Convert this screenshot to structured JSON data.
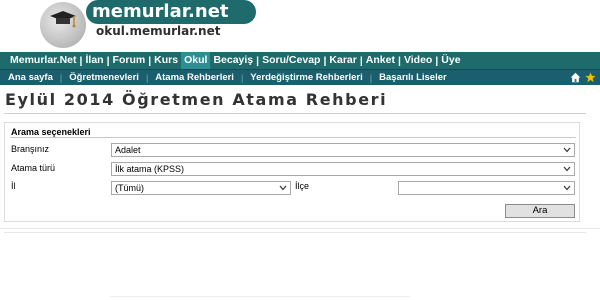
{
  "brand": {
    "logo_text": "memurlar.net",
    "sub_text": "okul.memurlar.net"
  },
  "main_nav": {
    "items": [
      {
        "label": "Memurlar.Net"
      },
      {
        "label": "İlan"
      },
      {
        "label": "Forum"
      },
      {
        "label": "Kurs"
      },
      {
        "label": "Okul",
        "active": true
      },
      {
        "label": "Becayiş"
      },
      {
        "label": "Soru/Cevap"
      },
      {
        "label": "Karar"
      },
      {
        "label": "Anket"
      },
      {
        "label": "Video"
      },
      {
        "label": "Üye"
      }
    ],
    "separator": "|"
  },
  "sub_nav": {
    "items": [
      {
        "label": "Ana sayfa"
      },
      {
        "label": "Öğretmenevleri"
      },
      {
        "label": "Atama Rehberleri"
      },
      {
        "label": "Yerdeğiştirme Rehberleri"
      },
      {
        "label": "Başarılı Liseler"
      }
    ],
    "separator": "|",
    "icons": [
      "home-icon",
      "star-icon"
    ],
    "accent": "#f2c200"
  },
  "page": {
    "title": "Eylül 2014 Öğretmen Atama Rehberi"
  },
  "search": {
    "panel_title": "Arama seçenekleri",
    "brans_label": "Branşınız",
    "brans_value": "Adalet",
    "atama_label": "Atama türü",
    "atama_value": "İlk atama (KPSS)",
    "il_label": "İl",
    "il_value": "(Tümü)",
    "ilce_label": "İlçe",
    "ilce_value": "",
    "button_label": "Ara"
  },
  "colors": {
    "main_nav_bg": "#1f6b6b",
    "sub_nav_bg": "#1b5e6e",
    "active_tab_bg": "#2e8f93"
  }
}
